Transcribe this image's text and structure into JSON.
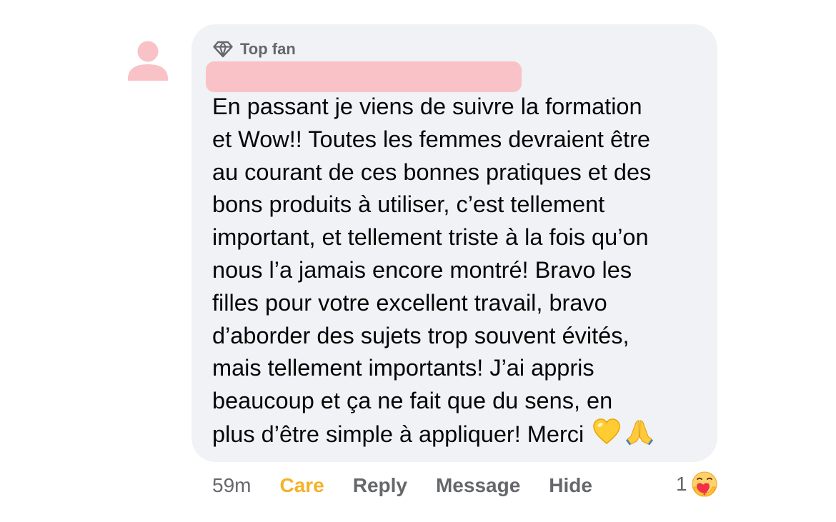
{
  "comment": {
    "badge": {
      "icon": "diamond-icon",
      "label": "Top fan"
    },
    "author_redacted": true,
    "text_lines": [
      "En passant je viens de suivre la formation",
      "et Wow!! Toutes les femmes devraient être",
      "au courant de ces bonnes pratiques et des",
      "bons produits à utiliser, c’est tellement",
      "important, et tellement triste à la fois qu’on",
      "nous l’a jamais encore montré! Bravo les",
      "filles pour votre excellent travail, bravo",
      "d’aborder des sujets trop souvent évités,",
      "mais tellement importants! J’ai appris",
      "beaucoup et ça ne fait que du sens, en",
      "plus d’être simple à appliquer! Merci"
    ],
    "trailing_emojis": [
      "yellow-heart-icon",
      "folded-hands-icon"
    ]
  },
  "actions": {
    "time": "59m",
    "care": "Care",
    "reply": "Reply",
    "message": "Message",
    "hide": "Hide"
  },
  "reaction": {
    "count": "1",
    "icon": "care-reaction-icon"
  },
  "colors": {
    "bubble": "#f0f2f5",
    "care": "#f7b125",
    "secondary_text": "#65676b",
    "redaction": "#f8c2c7",
    "avatar_placeholder": "#f8c2c7"
  }
}
